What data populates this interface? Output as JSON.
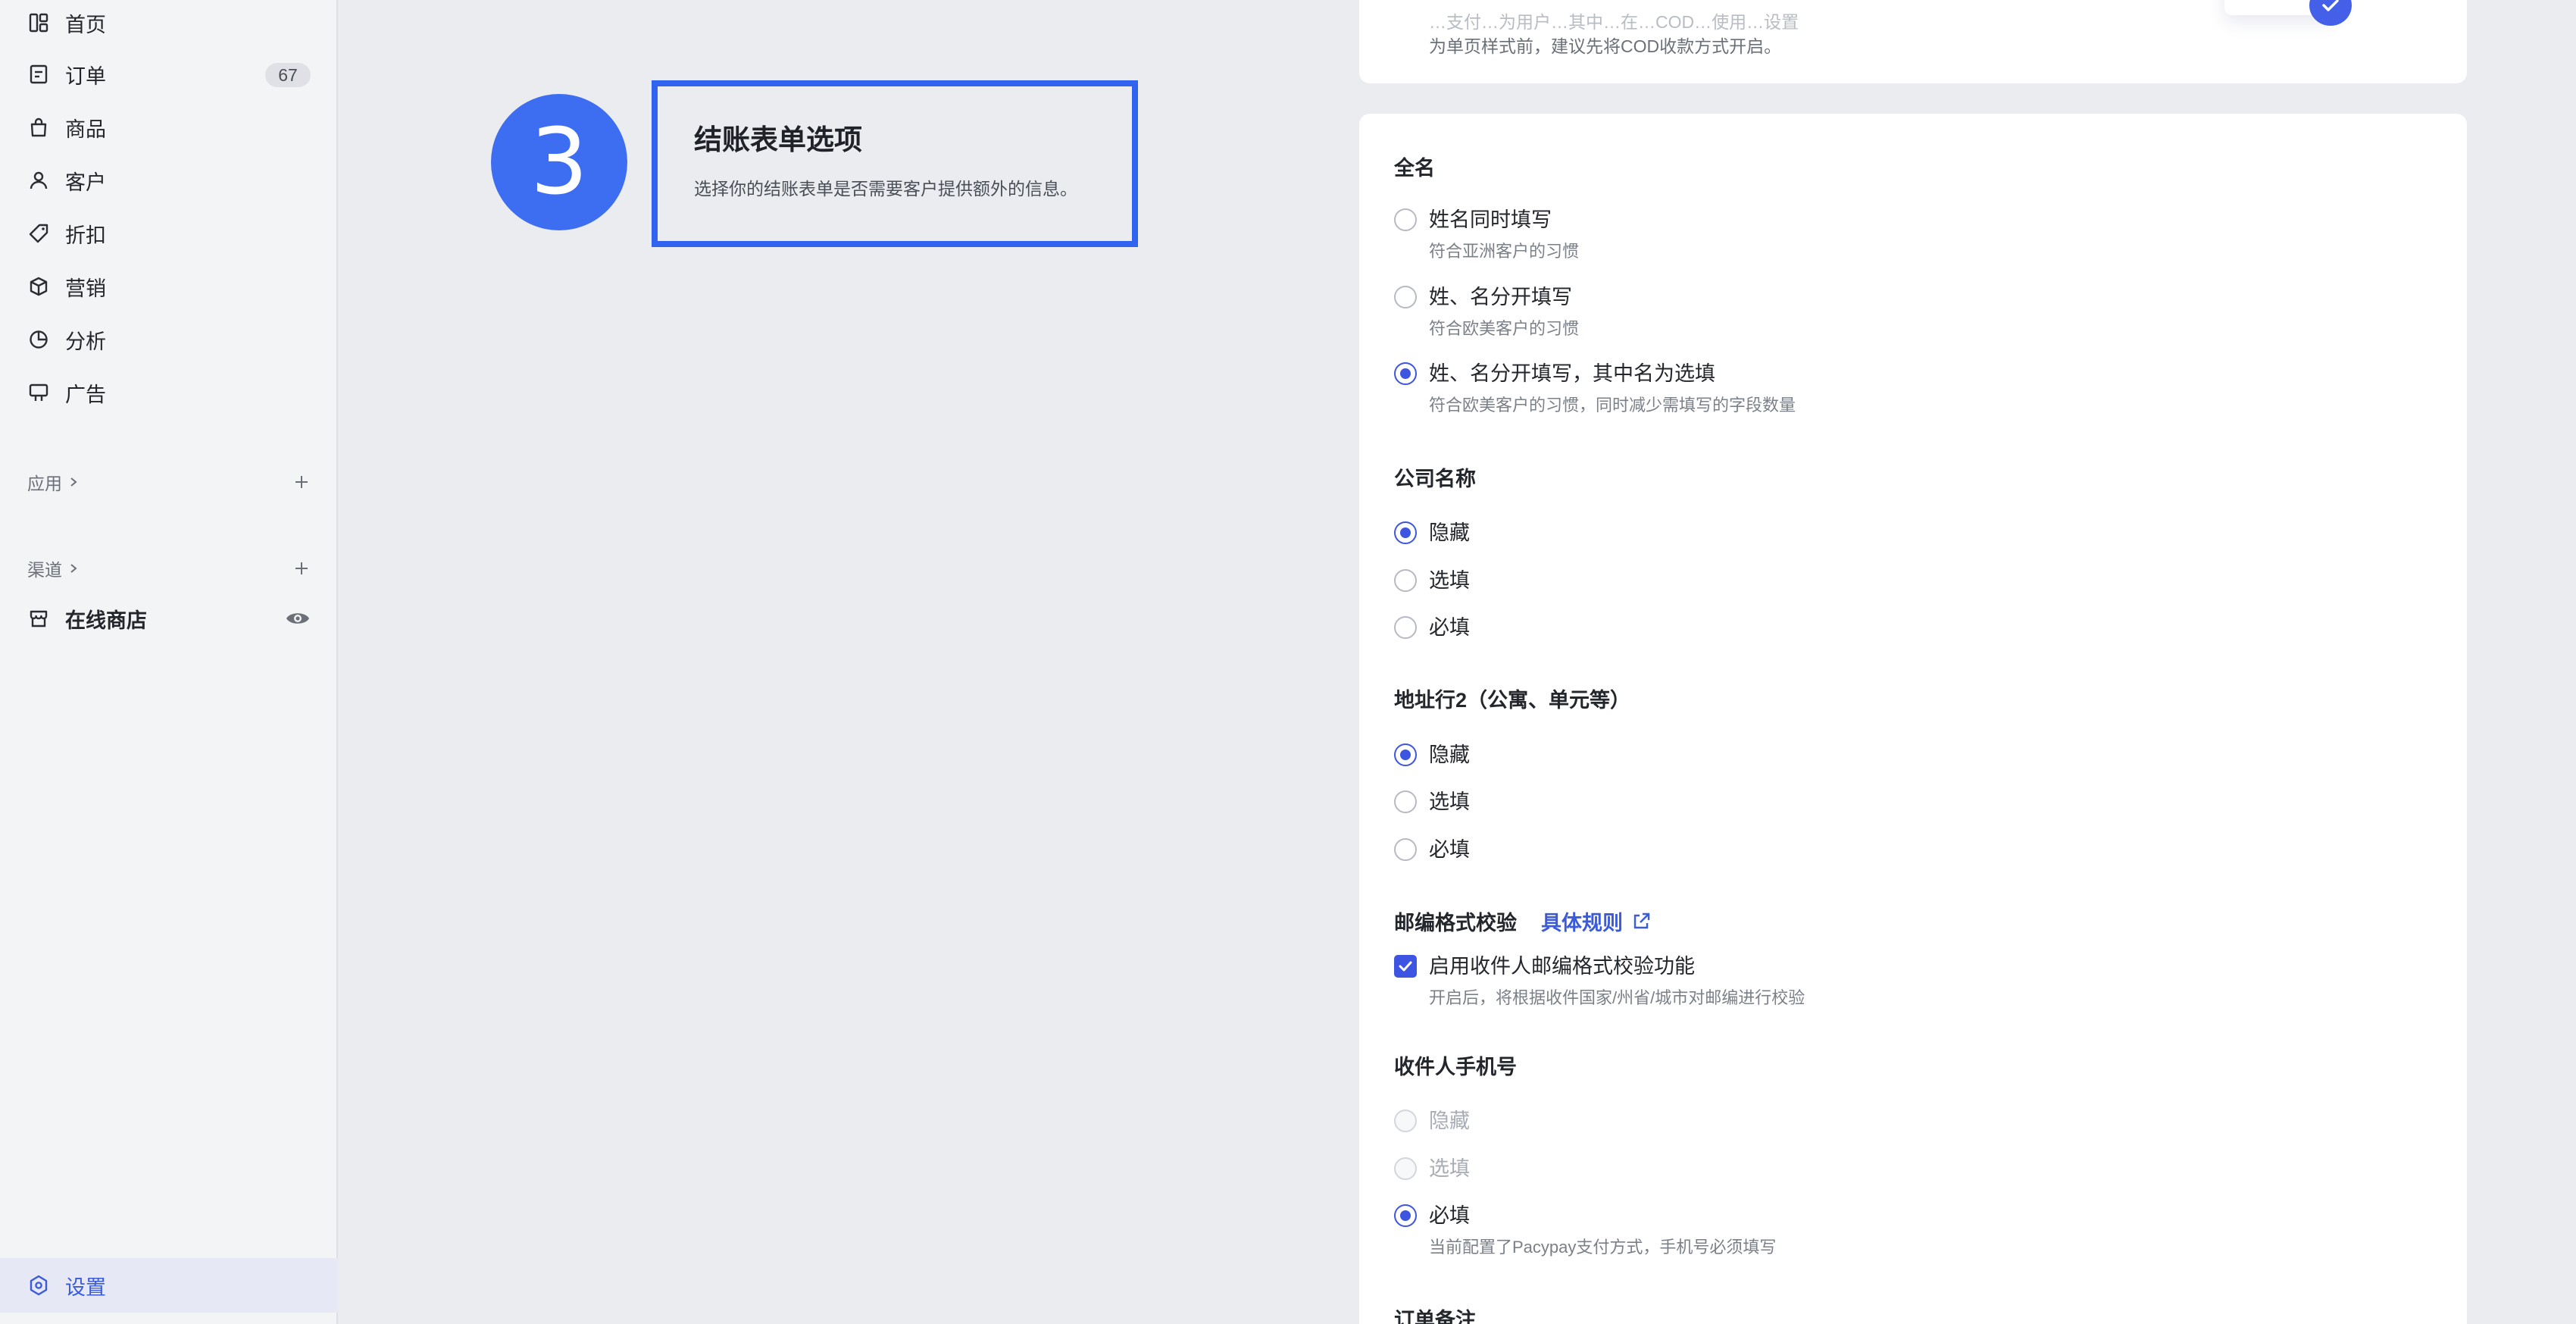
{
  "sidebar": {
    "items": [
      {
        "label": "首页",
        "icon": "home-icon"
      },
      {
        "label": "订单",
        "icon": "orders-icon",
        "badge": "67"
      },
      {
        "label": "商品",
        "icon": "shopping-bag-icon"
      },
      {
        "label": "客户",
        "icon": "user-icon"
      },
      {
        "label": "折扣",
        "icon": "tag-icon"
      },
      {
        "label": "营销",
        "icon": "cube-icon"
      },
      {
        "label": "分析",
        "icon": "pie-chart-icon"
      },
      {
        "label": "广告",
        "icon": "billboard-icon"
      }
    ],
    "apps_label": "应用",
    "channels_label": "渠道",
    "store_label": "在线商店",
    "settings_label": "设置"
  },
  "step": {
    "number": "3",
    "title": "结账表单选项",
    "description": "选择你的结账表单是否需要客户提供额外的信息。"
  },
  "top_card": {
    "line1": "…支付…为用户…其中…在…COD…使用…设置",
    "line2": "为单页样式前，建议先将COD收款方式开启。"
  },
  "form": {
    "fullname": {
      "title": "全名",
      "options": [
        {
          "label": "姓名同时填写",
          "sub": "符合亚洲客户的习惯",
          "selected": false
        },
        {
          "label": "姓、名分开填写",
          "sub": "符合欧美客户的习惯",
          "selected": false
        },
        {
          "label": "姓、名分开填写，其中名为选填",
          "sub": "符合欧美客户的习惯，同时减少需填写的字段数量",
          "selected": true
        }
      ]
    },
    "company": {
      "title": "公司名称",
      "options": [
        {
          "label": "隐藏",
          "selected": true
        },
        {
          "label": "选填",
          "selected": false
        },
        {
          "label": "必填",
          "selected": false
        }
      ]
    },
    "address2": {
      "title": "地址行2（公寓、单元等）",
      "options": [
        {
          "label": "隐藏",
          "selected": true
        },
        {
          "label": "选填",
          "selected": false
        },
        {
          "label": "必填",
          "selected": false
        }
      ]
    },
    "postal": {
      "title": "邮编格式校验",
      "link": "具体规则",
      "checkbox_label": "启用收件人邮编格式校验功能",
      "checkbox_sub": "开启后，将根据收件国家/州省/城市对邮编进行校验",
      "checked": true
    },
    "phone": {
      "title": "收件人手机号",
      "options": [
        {
          "label": "隐藏",
          "selected": false,
          "disabled": true
        },
        {
          "label": "选填",
          "selected": false,
          "disabled": true
        },
        {
          "label": "必填",
          "sub": "当前配置了Pacypay支付方式，手机号必须填写",
          "selected": true
        }
      ]
    },
    "order_note": {
      "title": "订单备注"
    }
  },
  "colors": {
    "accent": "#3d55e0",
    "step_blue": "#3d6ef2",
    "page_bg": "#eaecf0"
  }
}
